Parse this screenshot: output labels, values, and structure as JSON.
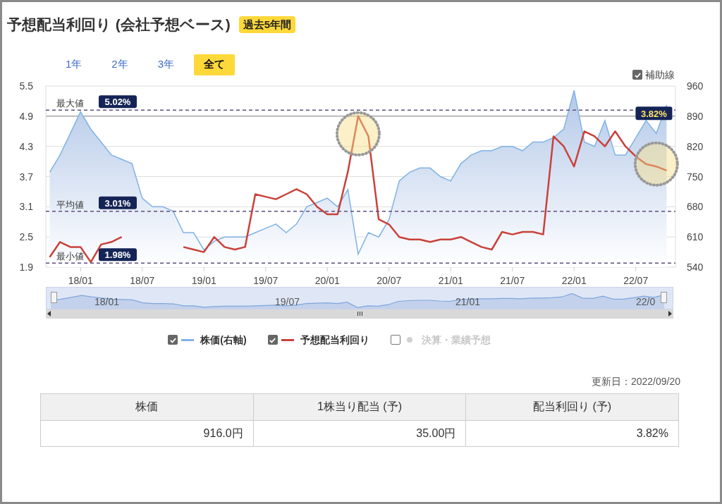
{
  "title": "予想配当利回り (会社予想ベース)",
  "period_badge": "過去5年間",
  "range_buttons": [
    {
      "label": "1年",
      "selected": false
    },
    {
      "label": "2年",
      "selected": false
    },
    {
      "label": "3年",
      "selected": false
    },
    {
      "label": "全て",
      "selected": true
    }
  ],
  "guide_toggle": {
    "label": "補助線",
    "checked": true
  },
  "chart": {
    "chart_data": {
      "type": "line",
      "ylim": [
        1.9,
        5.5
      ],
      "grid": true,
      "ref_lines": [
        {
          "axis": "y",
          "value": 5.02,
          "label": "最大値"
        },
        {
          "axis": "y",
          "value": 3.01,
          "label": "平均値"
        },
        {
          "axis": "y",
          "value": 1.98,
          "label": "最小値"
        },
        {
          "axis": "y",
          "value": 4.9
        }
      ],
      "categories": [
        null,
        null,
        null,
        "18/01",
        null,
        null,
        null,
        null,
        null,
        "18/07",
        null,
        null,
        null,
        null,
        null,
        "19/01",
        null,
        null,
        null,
        null,
        null,
        "19/07",
        null,
        null,
        null,
        null,
        null,
        "20/01",
        null,
        null,
        null,
        null,
        null,
        "20/07",
        null,
        null,
        null,
        null,
        null,
        "21/01",
        null,
        null,
        null,
        null,
        null,
        "21/07",
        null,
        null,
        null,
        null,
        null,
        "22/01",
        null,
        null,
        null,
        null,
        null,
        "22/07",
        null,
        null,
        null
      ],
      "yticks": [
        {
          "value": 5.5,
          "label": "5.5"
        },
        {
          "value": 4.9,
          "label": "4.9"
        },
        {
          "value": 4.3,
          "label": "4.3"
        },
        {
          "value": 3.7,
          "label": "3.7"
        },
        {
          "value": 3.1,
          "label": "3.1"
        },
        {
          "value": 2.5,
          "label": "2.5"
        },
        {
          "value": 1.9,
          "label": "1.9"
        }
      ],
      "y2lim": [
        540,
        960
      ],
      "y2ticks": [
        {
          "value": 960,
          "label": "960"
        },
        {
          "value": 890,
          "label": "890"
        },
        {
          "value": 820,
          "label": "820"
        },
        {
          "value": 750,
          "label": "750"
        },
        {
          "value": 680,
          "label": "680"
        },
        {
          "value": 610,
          "label": "610"
        },
        {
          "value": 540,
          "label": "540"
        }
      ],
      "series": [
        {
          "name": "株価(右軸)",
          "axis": "y2",
          "color": "#7fb2e5",
          "values": [
            760,
            800,
            850,
            900,
            860,
            830,
            800,
            790,
            780,
            700,
            680,
            680,
            670,
            620,
            620,
            580,
            600,
            610,
            610,
            610,
            620,
            630,
            640,
            620,
            640,
            680,
            690,
            700,
            680,
            720,
            570,
            620,
            610,
            650,
            740,
            760,
            770,
            770,
            750,
            740,
            780,
            800,
            810,
            810,
            820,
            820,
            810,
            830,
            830,
            840,
            860,
            950,
            830,
            820,
            880,
            800,
            800,
            840,
            880,
            850,
            916
          ]
        },
        {
          "name": "予想配当利回り",
          "color": "#c9413a",
          "values": [
            2.1,
            2.4,
            2.3,
            2.3,
            2.0,
            2.35,
            2.4,
            2.5,
            null,
            null,
            null,
            null,
            null,
            2.3,
            2.25,
            2.2,
            2.5,
            2.3,
            2.25,
            2.3,
            3.35,
            3.3,
            3.25,
            3.35,
            3.45,
            3.35,
            3.1,
            2.95,
            2.95,
            3.8,
            4.9,
            4.5,
            2.85,
            2.75,
            2.5,
            2.45,
            2.45,
            2.4,
            2.45,
            2.45,
            2.5,
            2.4,
            2.3,
            2.25,
            2.6,
            2.55,
            2.6,
            2.6,
            2.55,
            4.5,
            4.3,
            3.9,
            4.6,
            4.5,
            4.3,
            4.6,
            4.3,
            4.1,
            3.95,
            3.9,
            3.82
          ]
        }
      ]
    },
    "reference_values": [
      "5.02%",
      "3.01%",
      "1.98%"
    ],
    "current_value": "3.82%"
  },
  "navigator": {
    "labels": [
      "18/01",
      "19/07",
      "21/01",
      "22/0"
    ]
  },
  "legend": [
    {
      "checked": true,
      "disabled": false,
      "kind": "line"
    },
    {
      "checked": true,
      "disabled": false,
      "kind": "line"
    },
    {
      "label": "決算・業績予想",
      "checked": false,
      "disabled": true,
      "color": "#d0d0d0",
      "kind": "dot"
    }
  ],
  "updated": "更新日：2022/09/20",
  "table": {
    "columns": [
      "株価",
      "1株当り配当 (予)",
      "配当利回り (予)"
    ],
    "rows": [
      [
        "916.0円",
        "35.00円",
        "3.82%"
      ]
    ]
  }
}
